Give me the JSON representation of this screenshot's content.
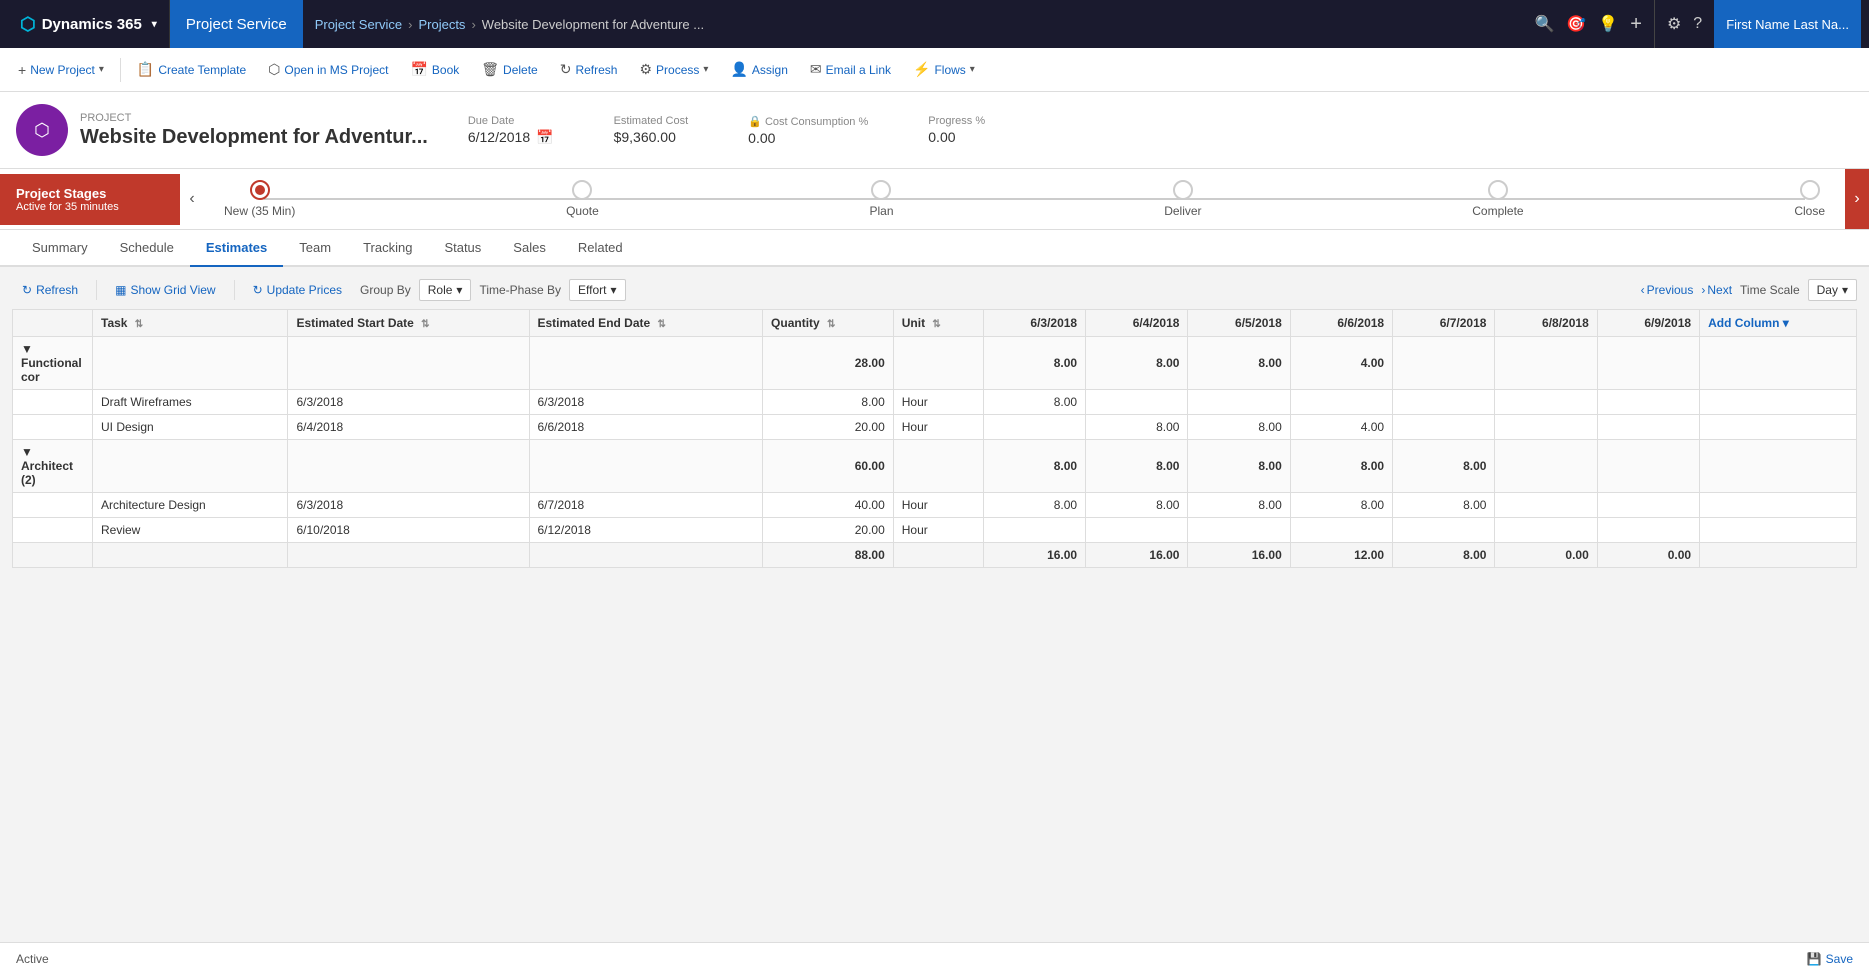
{
  "topNav": {
    "dynamics": "Dynamics 365",
    "app": "Project Service",
    "breadcrumb": [
      "Project Service",
      "Projects",
      "Website Development for Adventure ..."
    ]
  },
  "toolbar": {
    "buttons": [
      {
        "id": "new-project",
        "label": "New Project",
        "icon": "+",
        "hasDropdown": true
      },
      {
        "id": "create-template",
        "label": "Create Template",
        "icon": "📋",
        "hasDropdown": false
      },
      {
        "id": "open-ms-project",
        "label": "Open in MS Project",
        "icon": "⬡",
        "hasDropdown": false
      },
      {
        "id": "book",
        "label": "Book",
        "icon": "📅",
        "hasDropdown": false
      },
      {
        "id": "delete",
        "label": "Delete",
        "icon": "🗑",
        "hasDropdown": false
      },
      {
        "id": "refresh",
        "label": "Refresh",
        "icon": "↻",
        "hasDropdown": false
      },
      {
        "id": "process",
        "label": "Process",
        "icon": "⚙",
        "hasDropdown": true
      },
      {
        "id": "assign",
        "label": "Assign",
        "icon": "👤",
        "hasDropdown": false
      },
      {
        "id": "email-link",
        "label": "Email a Link",
        "icon": "✉",
        "hasDropdown": false
      },
      {
        "id": "flows",
        "label": "Flows",
        "icon": "⚡",
        "hasDropdown": true
      }
    ]
  },
  "project": {
    "label": "PROJECT",
    "title": "Website Development for Adventur...",
    "dueDate": {
      "label": "Due Date",
      "value": "6/12/2018"
    },
    "estimatedCost": {
      "label": "Estimated Cost",
      "value": "$9,360.00"
    },
    "costConsumption": {
      "label": "Cost Consumption %",
      "value": "0.00"
    },
    "progress": {
      "label": "Progress %",
      "value": "0.00"
    }
  },
  "stages": {
    "label": "Project Stages",
    "subLabel": "Active for 35 minutes",
    "items": [
      {
        "name": "New (35 Min)",
        "active": true
      },
      {
        "name": "Quote",
        "active": false
      },
      {
        "name": "Plan",
        "active": false
      },
      {
        "name": "Deliver",
        "active": false
      },
      {
        "name": "Complete",
        "active": false
      },
      {
        "name": "Close",
        "active": false
      }
    ]
  },
  "tabs": [
    "Summary",
    "Schedule",
    "Estimates",
    "Team",
    "Tracking",
    "Status",
    "Sales",
    "Related"
  ],
  "activeTab": "Estimates",
  "estimates": {
    "toolbar": {
      "refresh": "Refresh",
      "showGridView": "Show Grid View",
      "updatePrices": "Update Prices",
      "groupBy": "Group By",
      "groupByValue": "Role",
      "timePhasedBy": "Time-Phase By",
      "timePhasedValue": "Effort",
      "previous": "Previous",
      "next": "Next",
      "timeScale": "Time Scale",
      "timeScaleValue": "Day"
    },
    "columns": [
      {
        "id": "col0",
        "label": ""
      },
      {
        "id": "task",
        "label": "Task"
      },
      {
        "id": "startDate",
        "label": "Estimated Start Date"
      },
      {
        "id": "endDate",
        "label": "Estimated End Date"
      },
      {
        "id": "quantity",
        "label": "Quantity"
      },
      {
        "id": "unit",
        "label": "Unit"
      },
      {
        "id": "d6_3",
        "label": "6/3/2018"
      },
      {
        "id": "d6_4",
        "label": "6/4/2018"
      },
      {
        "id": "d6_5",
        "label": "6/5/2018"
      },
      {
        "id": "d6_6",
        "label": "6/6/2018"
      },
      {
        "id": "d6_7",
        "label": "6/7/2018"
      },
      {
        "id": "d6_8",
        "label": "6/8/2018"
      },
      {
        "id": "d6_9",
        "label": "6/9/2018"
      },
      {
        "id": "addCol",
        "label": "Add Column"
      }
    ],
    "groups": [
      {
        "id": "functional",
        "name": "Functional cor",
        "quantity": "28.00",
        "dates": {
          "6/3": "8.00",
          "6/4": "8.00",
          "6/5": "8.00",
          "6/6": "4.00",
          "6/7": "",
          "6/8": "",
          "6/9": ""
        },
        "tasks": [
          {
            "name": "Draft Wireframes",
            "start": "6/3/2018",
            "end": "6/3/2018",
            "quantity": "8.00",
            "unit": "Hour",
            "dates": {
              "6/3": "8.00",
              "6/4": "",
              "6/5": "",
              "6/6": "",
              "6/7": "",
              "6/8": "",
              "6/9": ""
            }
          },
          {
            "name": "UI Design",
            "start": "6/4/2018",
            "end": "6/6/2018",
            "quantity": "20.00",
            "unit": "Hour",
            "dates": {
              "6/3": "",
              "6/4": "8.00",
              "6/5": "8.00",
              "6/6": "4.00",
              "6/7": "",
              "6/8": "",
              "6/9": ""
            }
          }
        ]
      },
      {
        "id": "architect",
        "name": "Architect (2)",
        "quantity": "60.00",
        "dates": {
          "6/3": "8.00",
          "6/4": "8.00",
          "6/5": "8.00",
          "6/6": "8.00",
          "6/7": "8.00",
          "6/8": "",
          "6/9": ""
        },
        "tasks": [
          {
            "name": "Architecture Design",
            "start": "6/3/2018",
            "end": "6/7/2018",
            "quantity": "40.00",
            "unit": "Hour",
            "dates": {
              "6/3": "8.00",
              "6/4": "8.00",
              "6/5": "8.00",
              "6/6": "8.00",
              "6/7": "8.00",
              "6/8": "",
              "6/9": ""
            }
          },
          {
            "name": "Review",
            "start": "6/10/2018",
            "end": "6/12/2018",
            "quantity": "20.00",
            "unit": "Hour",
            "dates": {
              "6/3": "",
              "6/4": "",
              "6/5": "",
              "6/6": "",
              "6/7": "",
              "6/8": "",
              "6/9": ""
            }
          }
        ]
      }
    ],
    "totals": {
      "quantity": "88.00",
      "dates": {
        "6/3": "16.00",
        "6/4": "16.00",
        "6/5": "16.00",
        "6/6": "12.00",
        "6/7": "8.00",
        "6/8": "0.00",
        "6/9": "0.00"
      }
    }
  },
  "footer": {
    "status": "Active",
    "save": "Save"
  }
}
